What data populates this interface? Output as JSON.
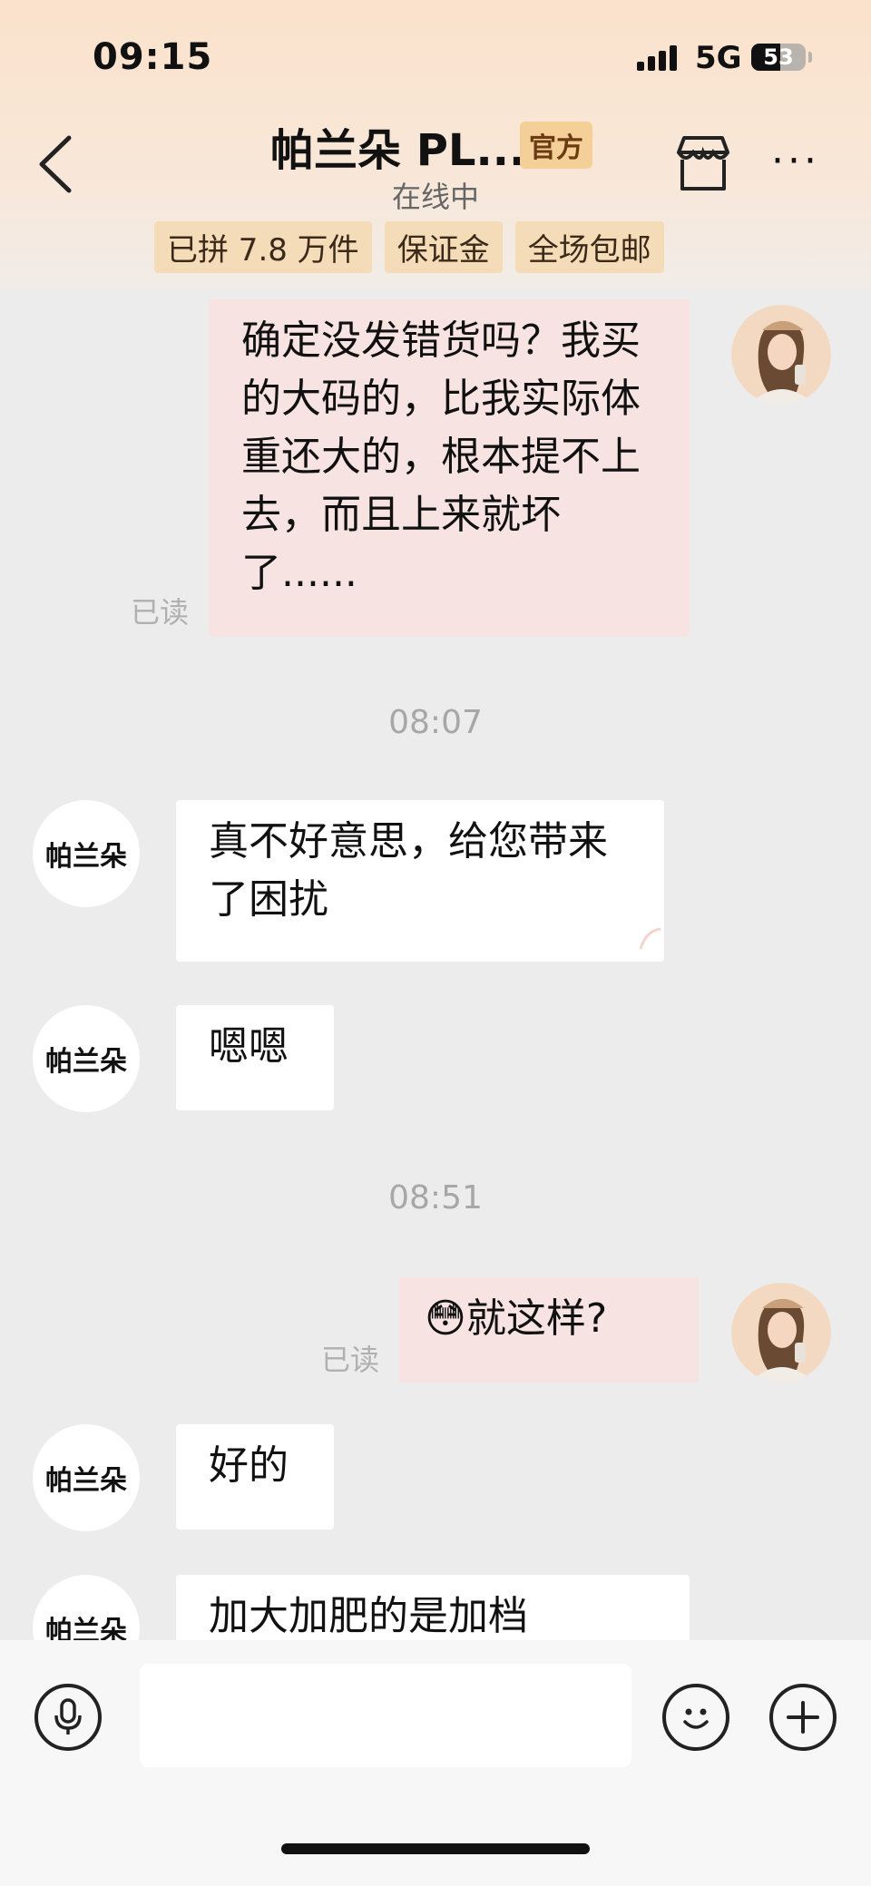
{
  "status_bar": {
    "time": "09:15",
    "network": "5G",
    "battery": "53",
    "battery_level_percent": 53
  },
  "header": {
    "title": "帕兰朵 PL...",
    "badge": "官方",
    "subtitle": "在线中",
    "tags": [
      "已拼 7.8 万件",
      "保证金",
      "全场包邮"
    ],
    "icons": {
      "back": "back-chevron-icon",
      "store": "store-icon",
      "more": "more-options-icon"
    }
  },
  "messages": {
    "m1": {
      "text": "确定没发错货吗？我买的大码的，比我实际体重还大的，根本提不上去，而且上来就坏了......",
      "read": "已读"
    },
    "ts1": "08:07",
    "m2": {
      "sender": "帕兰朵",
      "text": "真不好意思，给您带来了困扰"
    },
    "m3": {
      "sender": "帕兰朵",
      "text": "嗯嗯"
    },
    "ts2": "08:51",
    "m4": {
      "emoji": "😳",
      "text": "就这样?",
      "read": "已读"
    },
    "m5": {
      "sender": "帕兰朵",
      "text": "好的"
    },
    "m6": {
      "sender": "帕兰朵",
      "text": "加大加肥的是加档"
    }
  },
  "input_bar": {
    "text_value": "",
    "icons": [
      "microphone-icon",
      "emoji-icon",
      "plus-icon"
    ]
  },
  "colors": {
    "header_bg": "#fbe2cc",
    "own_bubble": "#f7e4e2",
    "shop_bubble": "#ffffff",
    "tag_bg": "#f4dcb8",
    "badge_bg": "#f4cf97"
  }
}
